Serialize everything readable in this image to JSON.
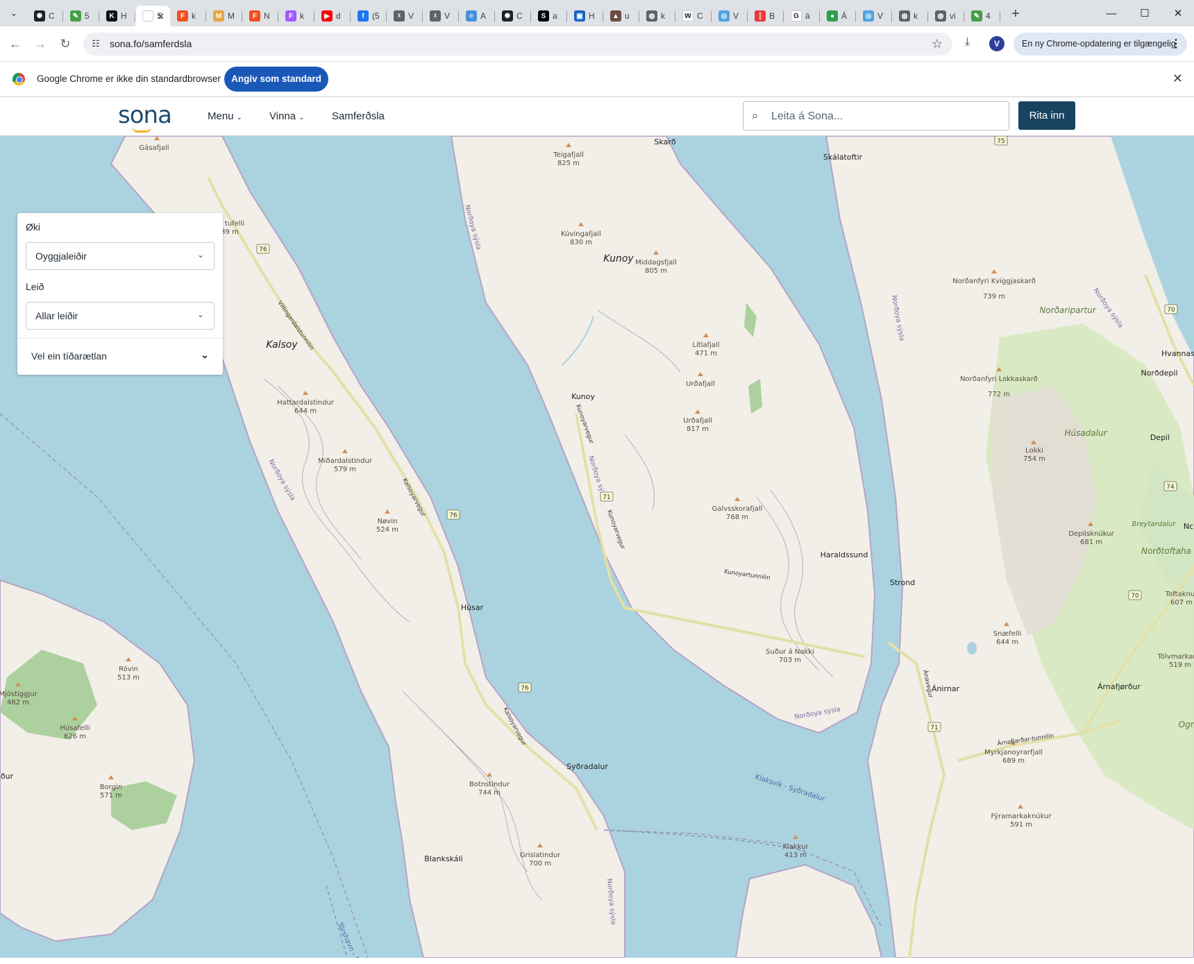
{
  "browser": {
    "tabs": [
      {
        "icon": "openai-icon",
        "title": "C",
        "color": "#202124",
        "glyph": "✺"
      },
      {
        "icon": "leaf-icon",
        "title": "5",
        "color": "#43a047",
        "glyph": "✎"
      },
      {
        "icon": "k-icon",
        "title": "H",
        "color": "#111111",
        "glyph": "K"
      },
      {
        "icon": "sona-icon",
        "title": "S",
        "color": "#ffffff",
        "glyph": "",
        "active": true
      },
      {
        "icon": "figma-icon",
        "title": "k",
        "color": "#f24e1e",
        "glyph": "F"
      },
      {
        "icon": "miro-icon",
        "title": "M",
        "color": "#e8a33d",
        "glyph": "M"
      },
      {
        "icon": "figma-icon",
        "title": "N",
        "color": "#f24e1e",
        "glyph": "F"
      },
      {
        "icon": "figma-icon",
        "title": "k",
        "color": "#a259ff",
        "glyph": "F"
      },
      {
        "icon": "youtube-icon",
        "title": "d",
        "color": "#ff0000",
        "glyph": "▶"
      },
      {
        "icon": "facebook-icon",
        "title": "(5",
        "color": "#1877f2",
        "glyph": "f"
      },
      {
        "icon": "x-icon",
        "title": "V",
        "color": "#5f6368",
        "glyph": "ᵡ"
      },
      {
        "icon": "x-icon",
        "title": "V",
        "color": "#5f6368",
        "glyph": "ᵡ"
      },
      {
        "icon": "doc-icon",
        "title": "A",
        "color": "#4a90d9",
        "glyph": "≡"
      },
      {
        "icon": "openai-icon",
        "title": "C",
        "color": "#202124",
        "glyph": "✺"
      },
      {
        "icon": "s-icon",
        "title": "a",
        "color": "#000000",
        "glyph": "S"
      },
      {
        "icon": "image-icon",
        "title": "H",
        "color": "#1565c0",
        "glyph": "▣"
      },
      {
        "icon": "mountain-icon",
        "title": "u",
        "color": "#6d4c41",
        "glyph": "▲"
      },
      {
        "icon": "globe-icon",
        "title": "k",
        "color": "#5f6368",
        "glyph": "◍"
      },
      {
        "icon": "wikipedia-icon",
        "title": "C",
        "color": "#ffffff",
        "glyph": "W"
      },
      {
        "icon": "spiral-icon",
        "title": "V",
        "color": "#4fa3e0",
        "glyph": "◎"
      },
      {
        "icon": "chart-icon",
        "title": "B",
        "color": "#e53935",
        "glyph": "║"
      },
      {
        "icon": "google-icon",
        "title": "á",
        "color": "#ffffff",
        "glyph": "G"
      },
      {
        "icon": "green-circle-icon",
        "title": "Á",
        "color": "#2e9e4f",
        "glyph": "●"
      },
      {
        "icon": "spiral-icon",
        "title": "V",
        "color": "#4fa3e0",
        "glyph": "◎"
      },
      {
        "icon": "globe-icon",
        "title": "k",
        "color": "#5f6368",
        "glyph": "◍"
      },
      {
        "icon": "globe-icon",
        "title": "vi",
        "color": "#5f6368",
        "glyph": "◍"
      },
      {
        "icon": "leaf-icon",
        "title": "4",
        "color": "#43a047",
        "glyph": "✎"
      }
    ],
    "url": "sona.fo/samferdsla",
    "update_chip": "En ny Chrome-opdatering er tilgængelig",
    "avatar_letter": "V",
    "infobar_message": "Google Chrome er ikke din standardbrowser",
    "infobar_button": "Angiv som standard"
  },
  "site": {
    "logo": "sona",
    "nav": {
      "menu": "Menu",
      "vinna": "Vinna",
      "samferdsla": "Samferðsla"
    },
    "search_placeholder": "Leita á Sona...",
    "login_button": "Rita inn"
  },
  "panel": {
    "oki_label": "Øki",
    "oki_value": "Oyggjaleiðir",
    "leid_label": "Leið",
    "leid_value": "Allar leiðir",
    "timetable_label": "Vel ein tíðarætlan"
  },
  "map": {
    "islands": {
      "kalsoy": "Kalsoy",
      "kunoy": "Kunoy"
    },
    "regions": {
      "nordaripartur": "Norðaripartur",
      "husadalur": "Húsadalur",
      "breytardalur": "Breytardalur",
      "nordtoftaha": "Norðtoftaha",
      "ogn": "Ogn"
    },
    "places": {
      "skard": "Skarð",
      "skalatoftir": "Skálatoftir",
      "kunoy_village": "Kunoy",
      "haraldssund": "Haraldssund",
      "strond": "Strond",
      "husar": "Húsar",
      "sydradalur": "Syðradalur",
      "blankskali": "Blankskáli",
      "anirnar": "Ánirnar",
      "arnafjordur": "Árnafjørður",
      "hvannas": "Hvannas",
      "nordepil": "Norðdepil",
      "depil": "Depil",
      "nc": "Nc",
      "dur": "ður"
    },
    "peaks": {
      "gasafjall": {
        "name": "Gásafjall",
        "elev": ""
      },
      "tufelli": {
        "name": "tufelli",
        "elev": "39 m"
      },
      "teigafjall": {
        "name": "Teigafjall",
        "elev": "825 m"
      },
      "kuvingafjall": {
        "name": "Kúvingafjall",
        "elev": "830 m"
      },
      "middagsfjall": {
        "name": "Middagsfjall",
        "elev": "805 m"
      },
      "litlafjall": {
        "name": "Lítlafjall",
        "elev": "471 m"
      },
      "urdafjall": {
        "name": "Urðafjall",
        "elev": ""
      },
      "urdafjall2": {
        "name": "Urðafjall",
        "elev": "817 m"
      },
      "galvsskorafjall": {
        "name": "Galvsskorafjall",
        "elev": "768 m"
      },
      "sudur": {
        "name": "Suður á Nakki",
        "elev": "703 m"
      },
      "hattardalstindur": {
        "name": "Hattardalstindur",
        "elev": "644 m"
      },
      "midardalstindur": {
        "name": "Miðardalstindur",
        "elev": "579 m"
      },
      "novin": {
        "name": "Nøvin",
        "elev": "524 m"
      },
      "botnstindur": {
        "name": "Botnstindur",
        "elev": "744 m"
      },
      "grislatindur": {
        "name": "Grislatindur",
        "elev": "700 m"
      },
      "rovin": {
        "name": "Róvin",
        "elev": "513 m"
      },
      "mjostiggjur": {
        "name": "Mjóstiggjur",
        "elev": "482 m"
      },
      "husafelli": {
        "name": "Húsafelli",
        "elev": "626 m"
      },
      "borgin": {
        "name": "Borgin",
        "elev": "571 m"
      },
      "klakkur": {
        "name": "Klakkur",
        "elev": "413 m"
      },
      "nordanfyri": {
        "name": "Norðanfyri Kvíggjaskarð",
        "elev": "739 m"
      },
      "nordanfyri2": {
        "name": "Norðanfyri Lokkaskarð",
        "elev": "772 m"
      },
      "lokki": {
        "name": "Lokki",
        "elev": "754 m"
      },
      "depilsknukur": {
        "name": "Depilsknúkur",
        "elev": "681 m"
      },
      "snaefelli": {
        "name": "Snæfelli",
        "elev": "644 m"
      },
      "myrkjanoyrarfjall": {
        "name": "Myrkjanoyrarfjall",
        "elev": "689 m"
      },
      "fyramarkaknukur": {
        "name": "Fýramarkaknúkur",
        "elev": "591 m"
      },
      "tolvmarkar": {
        "name": "Tólvmarkar",
        "elev": "519 m"
      },
      "toftaknu": {
        "name": "Toftaknu",
        "elev": "607 m"
      }
    },
    "boundaries": {
      "nordoya": "Norðoya sýsla"
    },
    "roads": {
      "kalsoyarvegur": "Kalsoyarvegur",
      "kunoyarvegur": "Kunoyarvegur",
      "kunoyartunnilin": "Kunoyartunnilin",
      "arnafjardar": "Árnafjarðar-tunnilin",
      "anavegur": "Ánavegur",
      "villingardalstunnilin": "Villingardalstunnilin"
    },
    "ferry": {
      "klaksvik": "Klaksvík - Syðradalur",
      "torshavn": "Tórshavn - S"
    },
    "shields": {
      "r75": "75",
      "r76a": "76",
      "r76b": "76",
      "r76c": "76",
      "r71a": "71",
      "r71b": "71",
      "r70a": "70",
      "r70b": "70",
      "r74": "74"
    }
  }
}
